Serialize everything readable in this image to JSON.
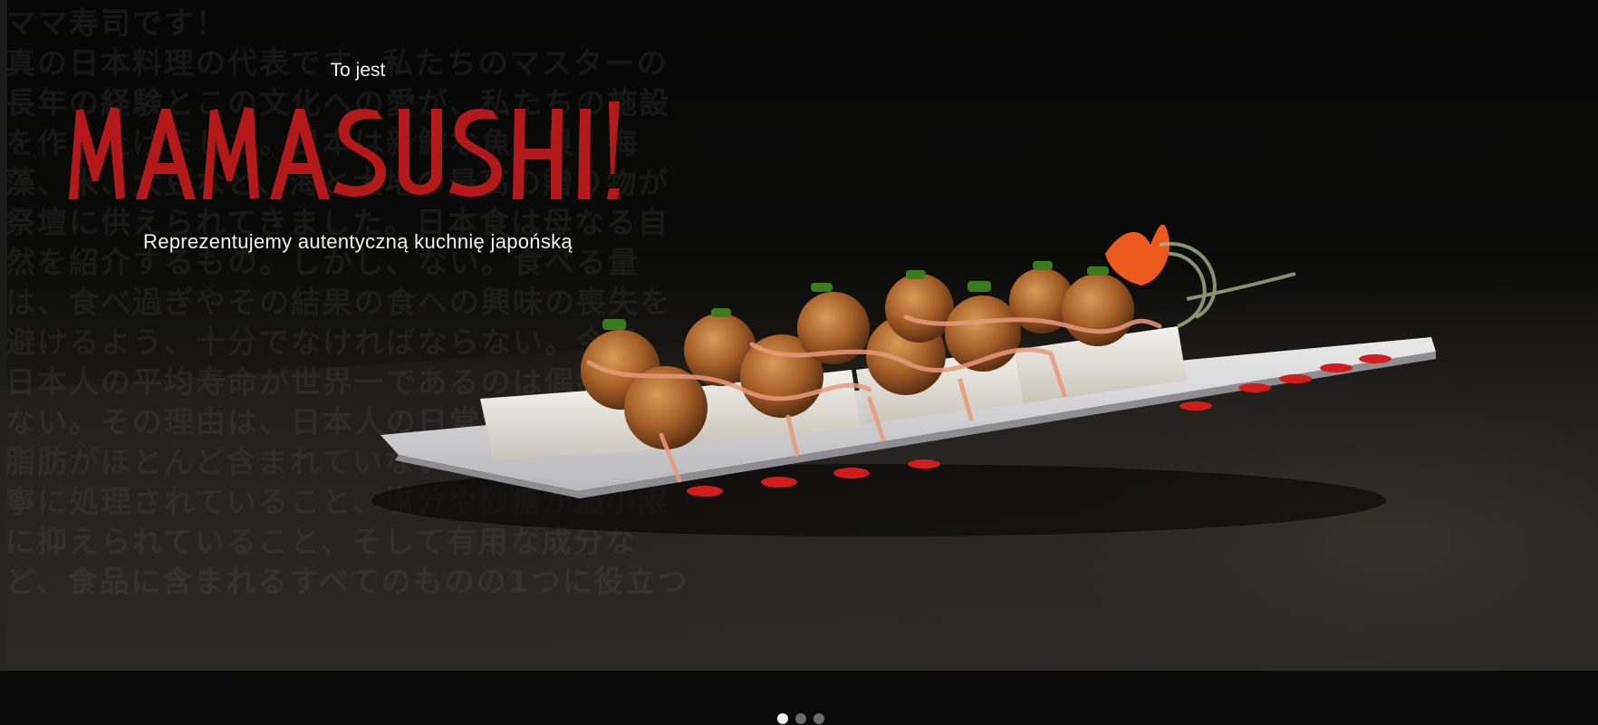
{
  "hero": {
    "background_text": {
      "title_line": "ママ寿司です！",
      "paragraph": "真の日本料理の代表です。私たちのマスターの長年の経験とこの文化への愛が、私たちの施設を作り上げました。日本は新鮮な魚、貝、海藻、米、大豆など、海と大地の最高の贈り物が祭壇に供えられてきました。日本食は母なる自然を紹介するもの。しかし、ない。食べる量は、食べ過ぎやその結果の食への興味の喪失を避けるよう、十分でなければならない。今日、日本人の平均寿命が世界一であるのは偶然ではない。その理由は、日本人の日常食には動物性脂肪がほとんど含まれていないこと、食材が丁寧に処理されていること、塩分や砂糖が最小限に抑えられていること、そして有用な成分など、食品に含まれるすべてのものの1つに役立つ"
    },
    "intro": "To jest",
    "logo_text": "MAMASUSHI!",
    "tagline": "Reprezentujemy autentyczną kuchnię japońską",
    "colors": {
      "brand_red": "#b3191a",
      "text_white": "#f2f2f2"
    }
  },
  "carousel": {
    "slide_count": 3,
    "active_slide": 1,
    "dots": [
      {
        "label": "slide-1",
        "active": true
      },
      {
        "label": "slide-2",
        "active": false
      },
      {
        "label": "slide-3",
        "active": false
      }
    ]
  }
}
